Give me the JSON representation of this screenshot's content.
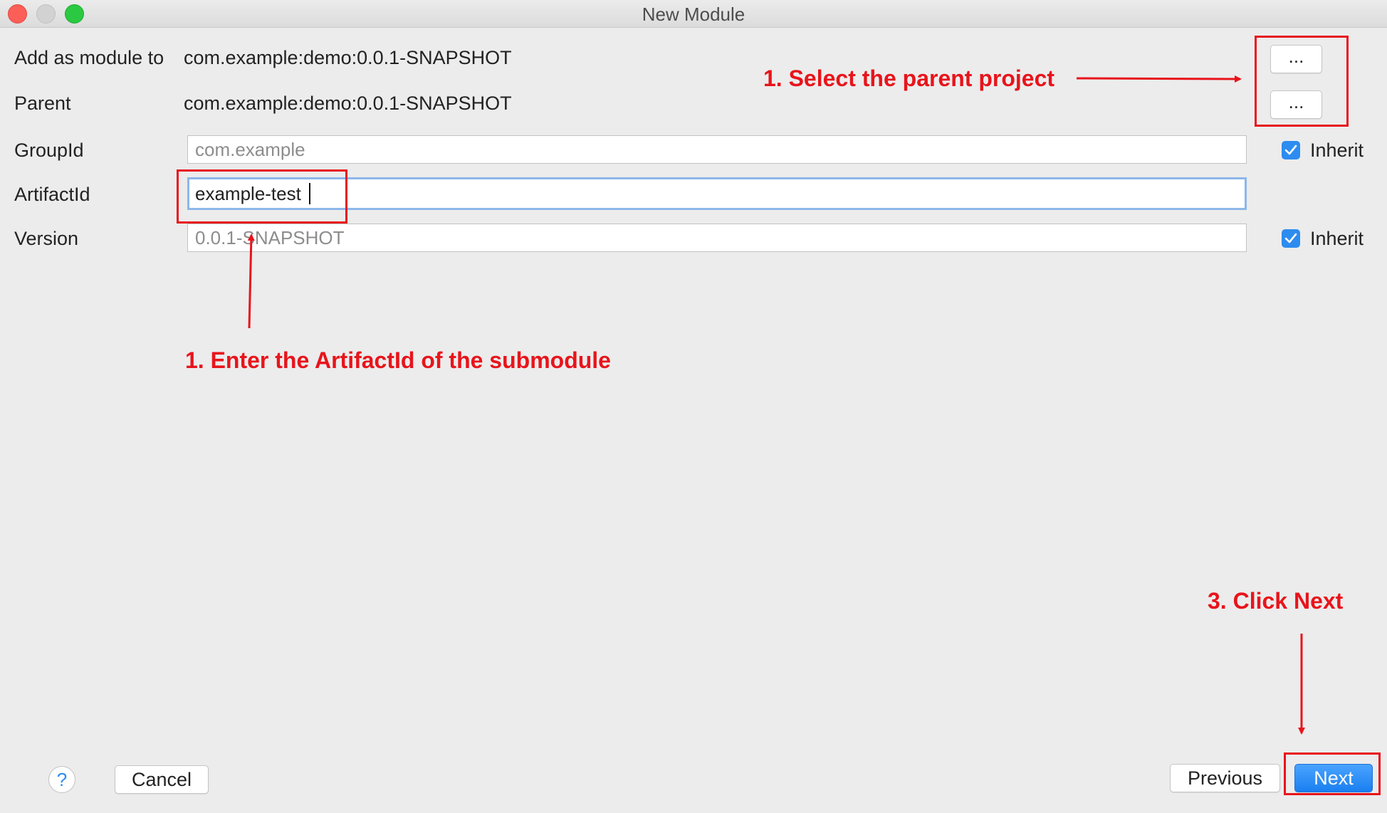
{
  "window": {
    "title": "New Module"
  },
  "form": {
    "add_as_module_label": "Add as module to",
    "add_as_module_value": "com.example:demo:0.0.1-SNAPSHOT",
    "parent_label": "Parent",
    "parent_value": "com.example:demo:0.0.1-SNAPSHOT",
    "group_id_label": "GroupId",
    "group_id_placeholder": "com.example",
    "artifact_id_label": "ArtifactId",
    "artifact_id_value": "example-test",
    "version_label": "Version",
    "version_placeholder": "0.0.1-SNAPSHOT",
    "inherit_label": "Inherit",
    "browse_label": "..."
  },
  "annotations": {
    "select_parent": "1. Select the parent project",
    "enter_artifact": "1. Enter the ArtifactId of the submodule",
    "click_next": "3. Click Next"
  },
  "footer": {
    "help_label": "?",
    "cancel_label": "Cancel",
    "previous_label": "Previous",
    "next_label": "Next"
  },
  "colors": {
    "annotation": "#e8141b",
    "accent": "#2d8cf0"
  }
}
